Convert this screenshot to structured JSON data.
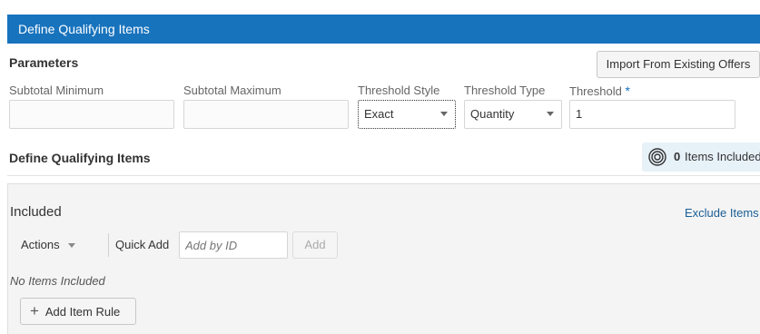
{
  "header": {
    "title": "Define Qualifying Items"
  },
  "parameters": {
    "heading": "Parameters",
    "import_button": "Import From Existing Offers",
    "subtotal_min": {
      "label": "Subtotal Minimum",
      "value": ""
    },
    "subtotal_max": {
      "label": "Subtotal Maximum",
      "value": ""
    },
    "threshold_style": {
      "label": "Threshold Style",
      "value": "Exact"
    },
    "threshold_type": {
      "label": "Threshold Type",
      "value": "Quantity"
    },
    "threshold": {
      "label": "Threshold",
      "required_mark": "*",
      "value": "1"
    }
  },
  "qualifying": {
    "heading": "Define Qualifying Items",
    "items_count": "0",
    "items_label": "Items Included",
    "panel": {
      "title": "Included",
      "exclude_link": "Exclude Items",
      "actions_label": "Actions",
      "quick_add_label": "Quick Add",
      "add_placeholder": "Add by ID",
      "add_button": "Add",
      "empty_text": "No Items Included",
      "add_rule_button": "Add Item Rule",
      "add_rule_icon": "+"
    }
  },
  "colors": {
    "brand": "#1873bd",
    "link": "#1a5e96"
  }
}
